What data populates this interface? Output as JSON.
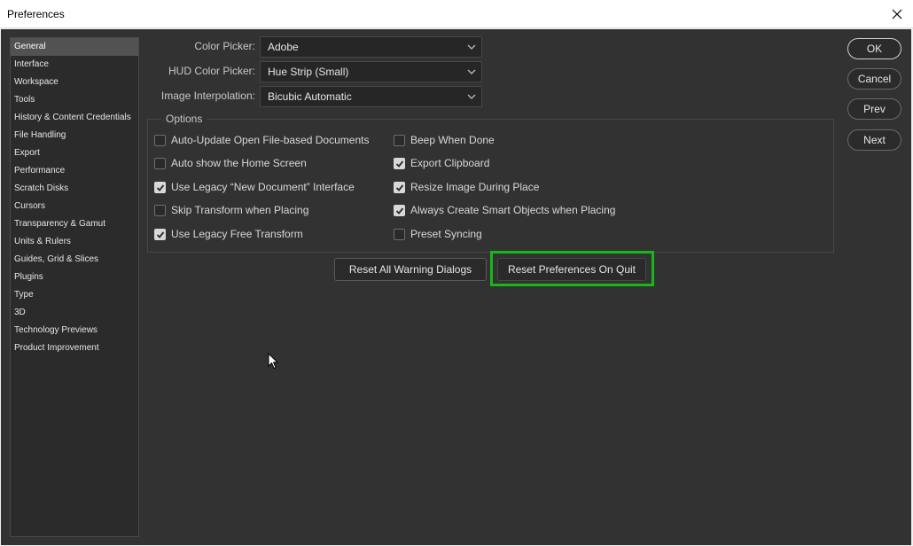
{
  "window": {
    "title": "Preferences"
  },
  "sidebar": {
    "items": [
      {
        "label": "General",
        "selected": true
      },
      {
        "label": "Interface"
      },
      {
        "label": "Workspace"
      },
      {
        "label": "Tools"
      },
      {
        "label": "History & Content Credentials"
      },
      {
        "label": "File Handling"
      },
      {
        "label": "Export"
      },
      {
        "label": "Performance"
      },
      {
        "label": "Scratch Disks"
      },
      {
        "label": "Cursors"
      },
      {
        "label": "Transparency & Gamut"
      },
      {
        "label": "Units & Rulers"
      },
      {
        "label": "Guides, Grid & Slices"
      },
      {
        "label": "Plugins"
      },
      {
        "label": "Type"
      },
      {
        "label": "3D"
      },
      {
        "label": "Technology Previews"
      },
      {
        "label": "Product Improvement"
      }
    ]
  },
  "fields": {
    "color_picker": {
      "label": "Color Picker:",
      "value": "Adobe"
    },
    "hud_color_picker": {
      "label": "HUD Color Picker:",
      "value": "Hue Strip (Small)"
    },
    "image_interpolation": {
      "label": "Image Interpolation:",
      "value": "Bicubic Automatic"
    }
  },
  "options": {
    "legend": "Options",
    "left": [
      {
        "label": "Auto-Update Open File-based Documents",
        "checked": false
      },
      {
        "label": "Auto show the Home Screen",
        "checked": false
      },
      {
        "label": "Use Legacy “New Document” Interface",
        "checked": true
      },
      {
        "label": "Skip Transform when Placing",
        "checked": false
      },
      {
        "label": "Use Legacy Free Transform",
        "checked": true
      }
    ],
    "right": [
      {
        "label": "Beep When Done",
        "checked": false
      },
      {
        "label": "Export Clipboard",
        "checked": true
      },
      {
        "label": "Resize Image During Place",
        "checked": true
      },
      {
        "label": "Always Create Smart Objects when Placing",
        "checked": true
      },
      {
        "label": "Preset Syncing",
        "checked": false
      }
    ]
  },
  "actions": {
    "reset_warnings": "Reset All Warning Dialogs",
    "reset_prefs": "Reset Preferences On Quit"
  },
  "buttons": {
    "ok": "OK",
    "cancel": "Cancel",
    "prev": "Prev",
    "next": "Next"
  },
  "colors": {
    "highlight": "#19b619",
    "panel": "#323232"
  }
}
